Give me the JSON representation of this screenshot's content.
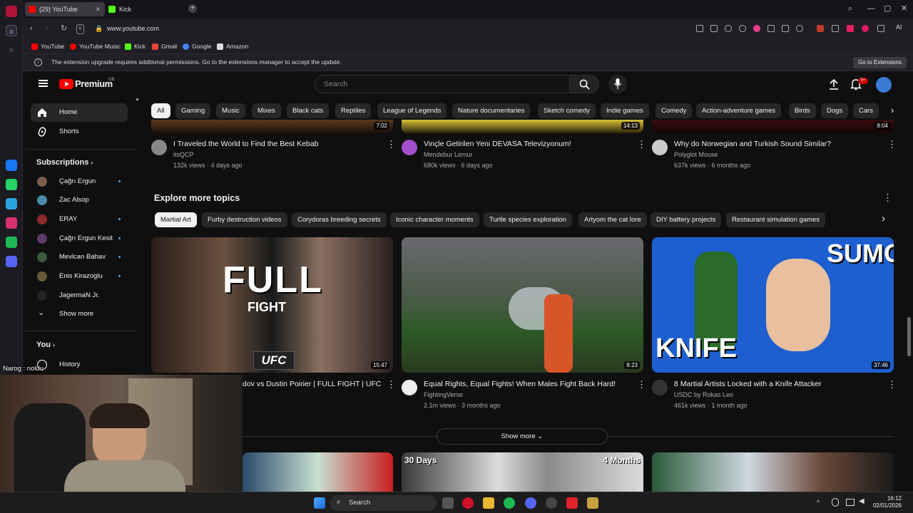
{
  "browser": {
    "tabs": [
      {
        "label": "(29) YouTube",
        "active": true
      },
      {
        "label": "Kick",
        "active": false
      }
    ],
    "url": "www.youtube.com",
    "bookmarks": [
      "YouTube",
      "YouTube Music",
      "Kick",
      "Gmail",
      "Google",
      "Amazon"
    ],
    "notice": "The extension upgrade requires additional permissions. Go to the extensions manager to accept the update.",
    "notice_button": "Go to Extensions",
    "ai_label": "AI"
  },
  "header": {
    "logo_text": "Premium",
    "region": "GB",
    "search_placeholder": "Search",
    "notif_count": "9+"
  },
  "guide": {
    "home": "Home",
    "shorts": "Shorts",
    "subscriptions_title": "Subscriptions",
    "subscriptions": [
      "Çağrı Ergun",
      "Zac Alsop",
      "ERAY",
      "Çağrı Ergun Kesit",
      "Mevlcan Bahav",
      "Enis Kirazoglu",
      "JagermaN Jr."
    ],
    "show_more": "Show more",
    "you_title": "You",
    "history": "History"
  },
  "chips": [
    "All",
    "Gaming",
    "Music",
    "Mixes",
    "Black cats",
    "Reptiles",
    "League of Legends",
    "Nature documentaries",
    "Sketch comedy",
    "Indie games",
    "Comedy",
    "Action-adventure games",
    "Birds",
    "Dogs",
    "Cars"
  ],
  "top_videos": [
    {
      "title": "I Traveled the World to Find the Best Kebab",
      "channel": "itsQCP",
      "meta": "132k views · 4 days ago",
      "duration": "7:02"
    },
    {
      "title": "Vinçle Getirilen Yeni DEVASA Televizyonum!",
      "channel": "Mendebur Lemur",
      "meta": "680k views · 6 days ago",
      "duration": "14:13"
    },
    {
      "title": "Why do Norwegian and Turkish Sound Similar?",
      "channel": "Polyglot Mouse",
      "meta": "637k views · 6 months ago",
      "duration": "8:04"
    }
  ],
  "explore": {
    "title": "Explore more topics",
    "topics": [
      "Martial Art",
      "Furby destruction videos",
      "Corydoras breeding secrets",
      "Iconic character moments",
      "Turtle species exploration",
      "Artyom the cat lore",
      "DIY battery projects",
      "Restaurant simulation games"
    ],
    "videos": [
      {
        "title": "dov vs Dustin Poirier | FULL FIGHT | UFC",
        "channel": "",
        "meta": "",
        "duration": "15:47",
        "thumb_text": "FULL",
        "thumb_sub": "FIGHT",
        "thumb_badge": "UFC"
      },
      {
        "title": "Equal Rights, Equal Fights! When Males Fight Back Hard!",
        "channel": "FightingVerse",
        "meta": "2.1m views · 3 months ago",
        "duration": "8:23"
      },
      {
        "title": "8 Martial Artists Locked with a Knife Attacker",
        "channel": "USDC by Rokas Leo",
        "meta": "461k views · 1 month ago",
        "duration": "37:46",
        "thumb_text": "SUMO",
        "thumb_sub": "KNIFE"
      }
    ],
    "show_more": "Show more"
  },
  "bottom_thumbs": [
    "30 Days",
    "4 Months"
  ],
  "chat": {
    "text": "Narog : noldu"
  },
  "taskbar": {
    "search": "Search",
    "time": "16:12",
    "date": "02/01/2026"
  }
}
